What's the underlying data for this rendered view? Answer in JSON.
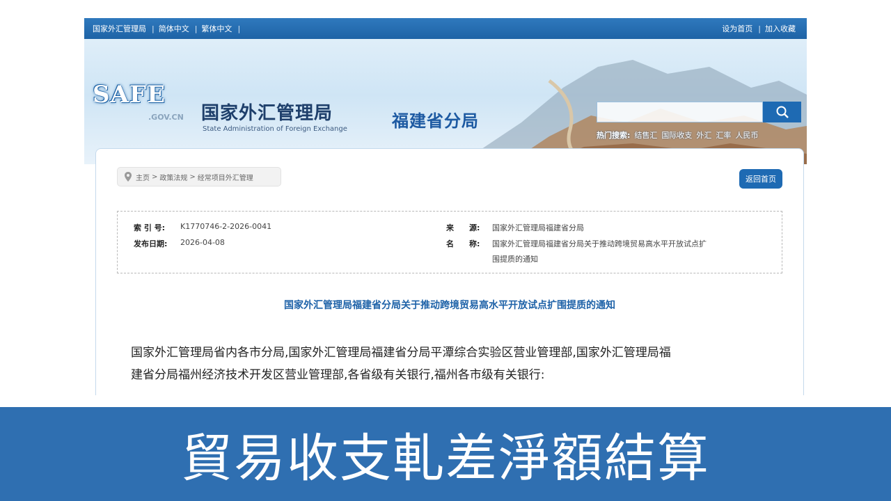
{
  "topbar": {
    "left_links": [
      "国家外汇管理局",
      "简体中文",
      "繁体中文"
    ],
    "set_home": "设为首页",
    "add_favorite": "加入收藏"
  },
  "header": {
    "logo_text": "SAFE",
    "logo_domain": ".GOV.CN",
    "org_name_cn": "国家外汇管理局",
    "org_name_en": "State Administration of Foreign Exchange",
    "branch_name": "福建省分局",
    "hot_search_label": "热门搜索:",
    "hot_search_terms": [
      "结售汇",
      "国际收支",
      "外汇",
      "汇率",
      "人民币"
    ]
  },
  "breadcrumb": {
    "home": "主页",
    "level1": "政策法规",
    "level2": "经常项目外汇管理",
    "sep": ">"
  },
  "back_button": "返回首页",
  "meta": {
    "index_label": "索 引 号:",
    "index_value": "K1770746-2-2026-0041",
    "date_label": "发布日期:",
    "date_value": "2026-04-08",
    "source_label": "来　　源:",
    "source_value": "国家外汇管理局福建省分局",
    "name_label": "名　　称:",
    "name_value_line1": "国家外汇管理局福建省分局关于推动跨境贸易高水平开放试点扩",
    "name_value_line2": "围提质的通知"
  },
  "document": {
    "title": "国家外汇管理局福建省分局关于推动跨境贸易高水平开放试点扩围提质的通知",
    "body_line1": "国家外汇管理局省内各市分局,国家外汇管理局福建省分局平潭综合实验区营业管理部,国家外汇管理局福",
    "body_line2": "建省分局福州经济技术开发区营业管理部,各省级有关银行,福州各市级有关银行:"
  },
  "caption": {
    "text": "貿易收支軋差淨額結算"
  }
}
